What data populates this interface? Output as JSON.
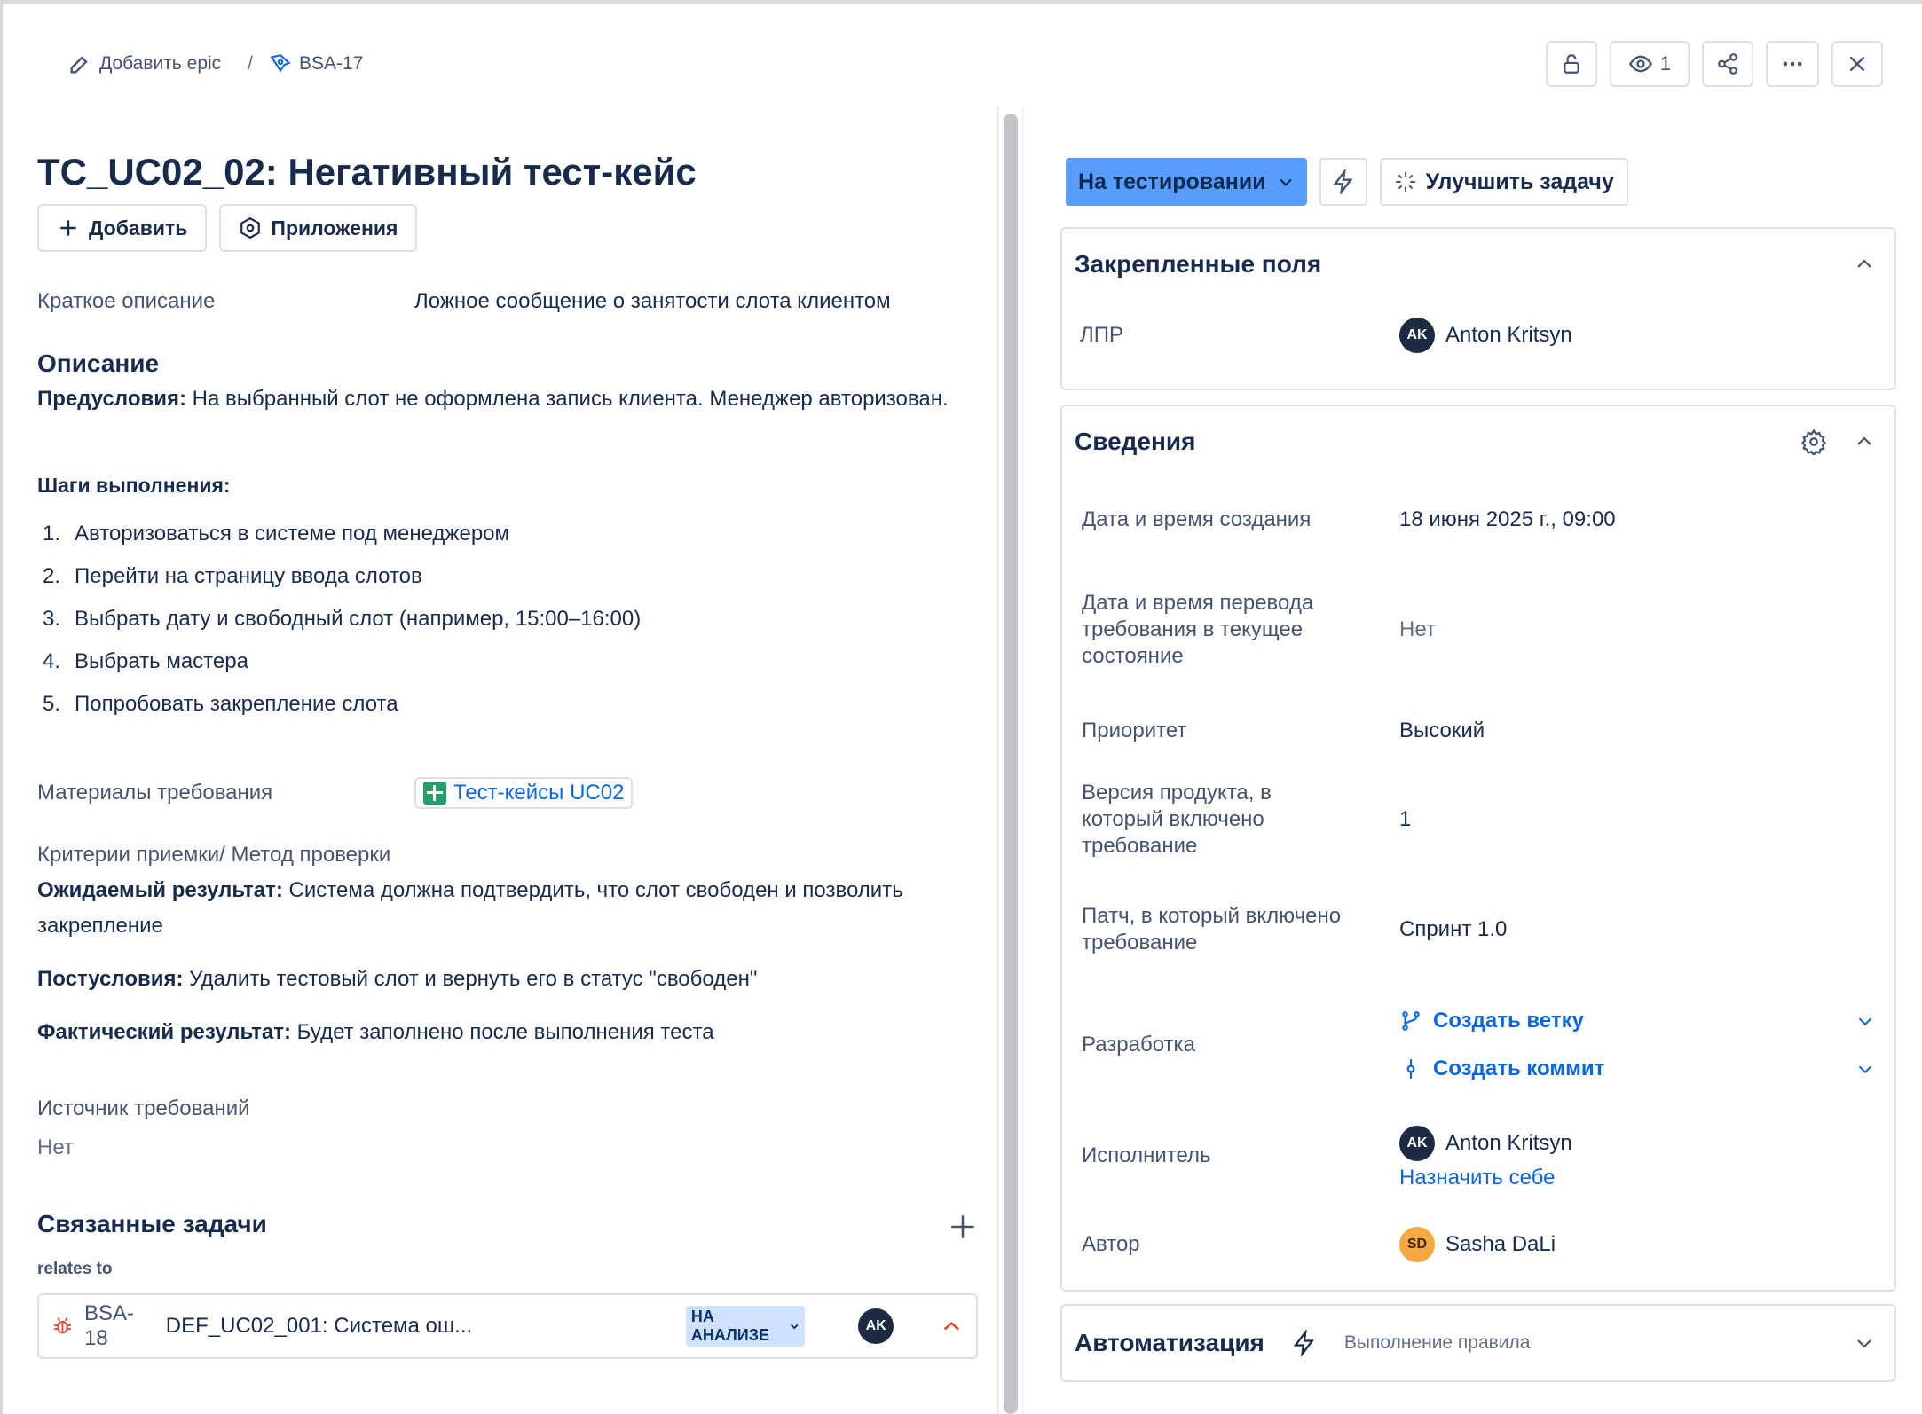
{
  "breadcrumb": {
    "add_epic": "Добавить epic",
    "separator": "/",
    "issue_key": "BSA-17"
  },
  "toolbar": {
    "watchers_count": "1"
  },
  "issue": {
    "title": "TC_UC02_02: Негативный тест-кейс",
    "add_button": "Добавить",
    "apps_button": "Приложения",
    "short_desc_label": "Краткое описание",
    "short_desc_value": "Ложное сообщение о занятости слота клиентом",
    "description_heading": "Описание",
    "preconditions_label": "Предусловия:",
    "preconditions_text": " На выбранный слот не оформлена запись клиента. Менеджер авторизован.",
    "steps_heading": "Шаги выполнения:",
    "steps": [
      {
        "num": "1.",
        "text": "Авторизоваться в системе под менеджером"
      },
      {
        "num": "2.",
        "text": "Перейти на страницу ввода слотов"
      },
      {
        "num": "3.",
        "text": "Выбрать дату и свободный слот (например, 15:00–16:00)"
      },
      {
        "num": "4.",
        "text": "Выбрать мастера"
      },
      {
        "num": "5.",
        "text": "Попробовать закрепление слота"
      }
    ],
    "materials_label": "Материалы требования",
    "materials_link": "Тест-кейсы UC02",
    "criteria_label": "Критерии приемки/ Метод проверки",
    "expected_label": "Ожидаемый результат:",
    "expected_text": " Система должна подтвердить, что слот свободен и позволить закрепление",
    "postconditions_label": "Постусловия:",
    "postconditions_text": " Удалить тестовый слот и вернуть его в статус \"свободен\"",
    "actual_label": "Фактический результат:",
    "actual_text": " Будет заполнено после выполнения теста",
    "source_label": "Источник требований",
    "source_value": "Нет",
    "related_heading": "Связанные задачи",
    "relates_to": "relates to",
    "related_issue": {
      "key": "BSA-18",
      "summary": "DEF_UC02_001: Система ош...",
      "status": "НА АНАЛИЗЕ",
      "assignee_initials": "AK"
    }
  },
  "right": {
    "status_button": "На тестировании",
    "improve_button": "Улучшить задачу",
    "pinned": {
      "title": "Закрепленные поля",
      "lpr_label": "ЛПР",
      "lpr_initials": "AK",
      "lpr_name": "Anton Kritsyn"
    },
    "details": {
      "title": "Сведения",
      "created_label": "Дата и время создания",
      "created_value": "18 июня 2025 г., 09:00",
      "transition_label": "Дата и время перевода требования в текущее состояние",
      "transition_value": "Нет",
      "priority_label": "Приоритет",
      "priority_value": "Высокий",
      "version_label": "Версия продукта, в который включено требование",
      "version_value": "1",
      "patch_label": "Патч, в который включено требование",
      "patch_value": "Спринт 1.0",
      "dev_label": "Разработка",
      "create_branch": "Создать ветку",
      "create_commit": "Создать коммит",
      "assignee_label": "Исполнитель",
      "assignee_initials": "AK",
      "assignee_name": "Anton Kritsyn",
      "assign_self": "Назначить себе",
      "author_label": "Автор",
      "author_initials": "SD",
      "author_name": "Sasha DaLi"
    },
    "automation": {
      "title": "Автоматизация",
      "subtitle": "Выполнение правила"
    }
  },
  "colors": {
    "accent": "#579dff",
    "link": "#0c66e4",
    "bug_icon": "#e34935"
  }
}
